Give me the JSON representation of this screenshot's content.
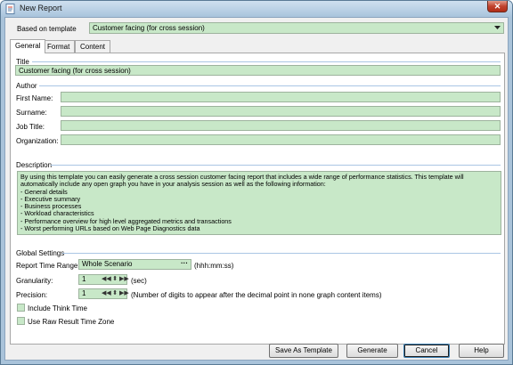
{
  "window": {
    "title": "New Report",
    "close_glyph": "✕"
  },
  "template": {
    "label": "Based on template",
    "value": "Customer facing (for cross session)"
  },
  "tabs": [
    "General",
    "Format",
    "Content"
  ],
  "title_section": {
    "header": "Title",
    "value": "Customer facing (for cross session)"
  },
  "author_section": {
    "header": "Author",
    "fields": [
      {
        "label": "First Name:",
        "value": ""
      },
      {
        "label": "Surname:",
        "value": ""
      },
      {
        "label": "Job Title:",
        "value": ""
      },
      {
        "label": "Organization:",
        "value": ""
      }
    ]
  },
  "description_section": {
    "header": "Description",
    "text": "By using this template you can easily generate a cross session customer facing report that includes a wide range of performance statistics. This template will automatically include any open graph you have in your analysis session as well as the following information:\n- General details\n- Executive summary\n- Business processes\n- Workload characteristics\n- Performance overview for high level aggregated metrics and transactions\n- Worst performing URLs based on Web Page Diagnostics data"
  },
  "global_section": {
    "header": "Global Settings",
    "time_range_label": "Report Time Range:",
    "time_range_value": "Whole Scenario",
    "time_range_button": "···",
    "time_range_hint": "(hhh:mm:ss)",
    "granularity_label": "Granularity:",
    "granularity_value": "1",
    "granularity_unit": "(sec)",
    "precision_label": "Precision:",
    "precision_value": "1",
    "precision_hint": "(Number of digits to appear after the decimal point in none graph content items)",
    "think_time_label": "Include Think Time",
    "think_time_checked": false,
    "raw_time_label": "Use Raw Result Time Zone",
    "raw_time_checked": false
  },
  "buttons": {
    "save_template": "Save As Template",
    "generate": "Generate",
    "cancel": "Cancel",
    "help": "Help"
  },
  "colors": {
    "field_bg": "#c8e8c8",
    "section_line": "#aac6e4",
    "title_bar": "#a9c4dc"
  }
}
